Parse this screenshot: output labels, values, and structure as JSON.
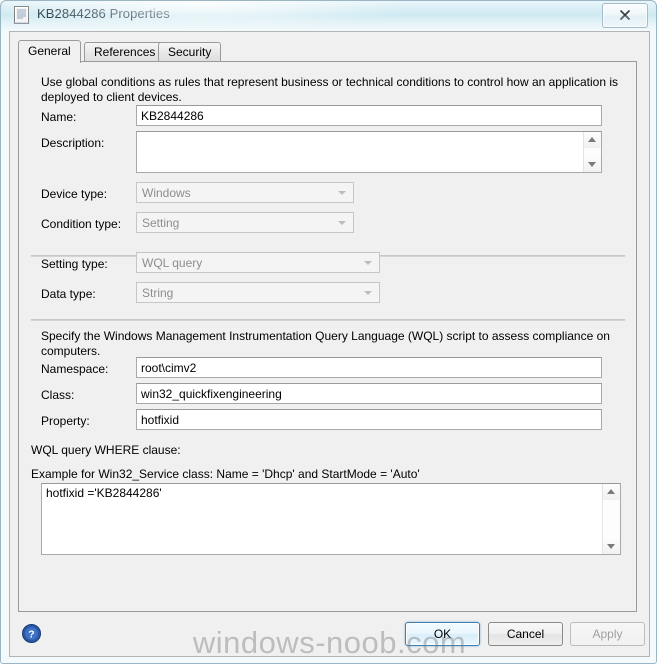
{
  "window": {
    "title": "KB2844286 Properties",
    "icon": "properties-document-icon",
    "close_label": "✕"
  },
  "tabs": [
    {
      "label": "General",
      "active": true
    },
    {
      "label": "References",
      "active": false
    },
    {
      "label": "Security",
      "active": false
    }
  ],
  "general": {
    "intro_text": "Use global conditions as rules that represent business or technical conditions to control how an application is deployed to client devices.",
    "name_label": "Name:",
    "name_value": "KB2844286",
    "description_label": "Description:",
    "description_value": "",
    "device_type_label": "Device type:",
    "device_type_value": "Windows",
    "condition_type_label": "Condition type:",
    "condition_type_value": "Setting",
    "setting_type_label": "Setting type:",
    "setting_type_value": "WQL query",
    "data_type_label": "Data type:",
    "data_type_value": "String",
    "wql_intro_text": "Specify the Windows Management Instrumentation Query Language (WQL) script to assess compliance on computers.",
    "namespace_label": "Namespace:",
    "namespace_value": "root\\cimv2",
    "class_label": "Class:",
    "class_value": "win32_quickfixengineering",
    "property_label": "Property:",
    "property_value": "hotfixid",
    "where_clause_label": "WQL query WHERE clause:",
    "where_clause_example": "Example for Win32_Service class: Name = 'Dhcp' and StartMode = 'Auto'",
    "where_clause_value": "hotfixid ='KB2844286'"
  },
  "footer": {
    "help_icon": "help-question-icon",
    "ok_label": "OK",
    "cancel_label": "Cancel",
    "apply_label": "Apply"
  },
  "watermark": {
    "text": "windows-noob.com"
  },
  "colors": {
    "default_button_border": "#3c7fb1",
    "dialog_background": "#f0f0f0",
    "disabled_text": "#8d8d8d",
    "help_icon_blue": "#2a58a8"
  }
}
